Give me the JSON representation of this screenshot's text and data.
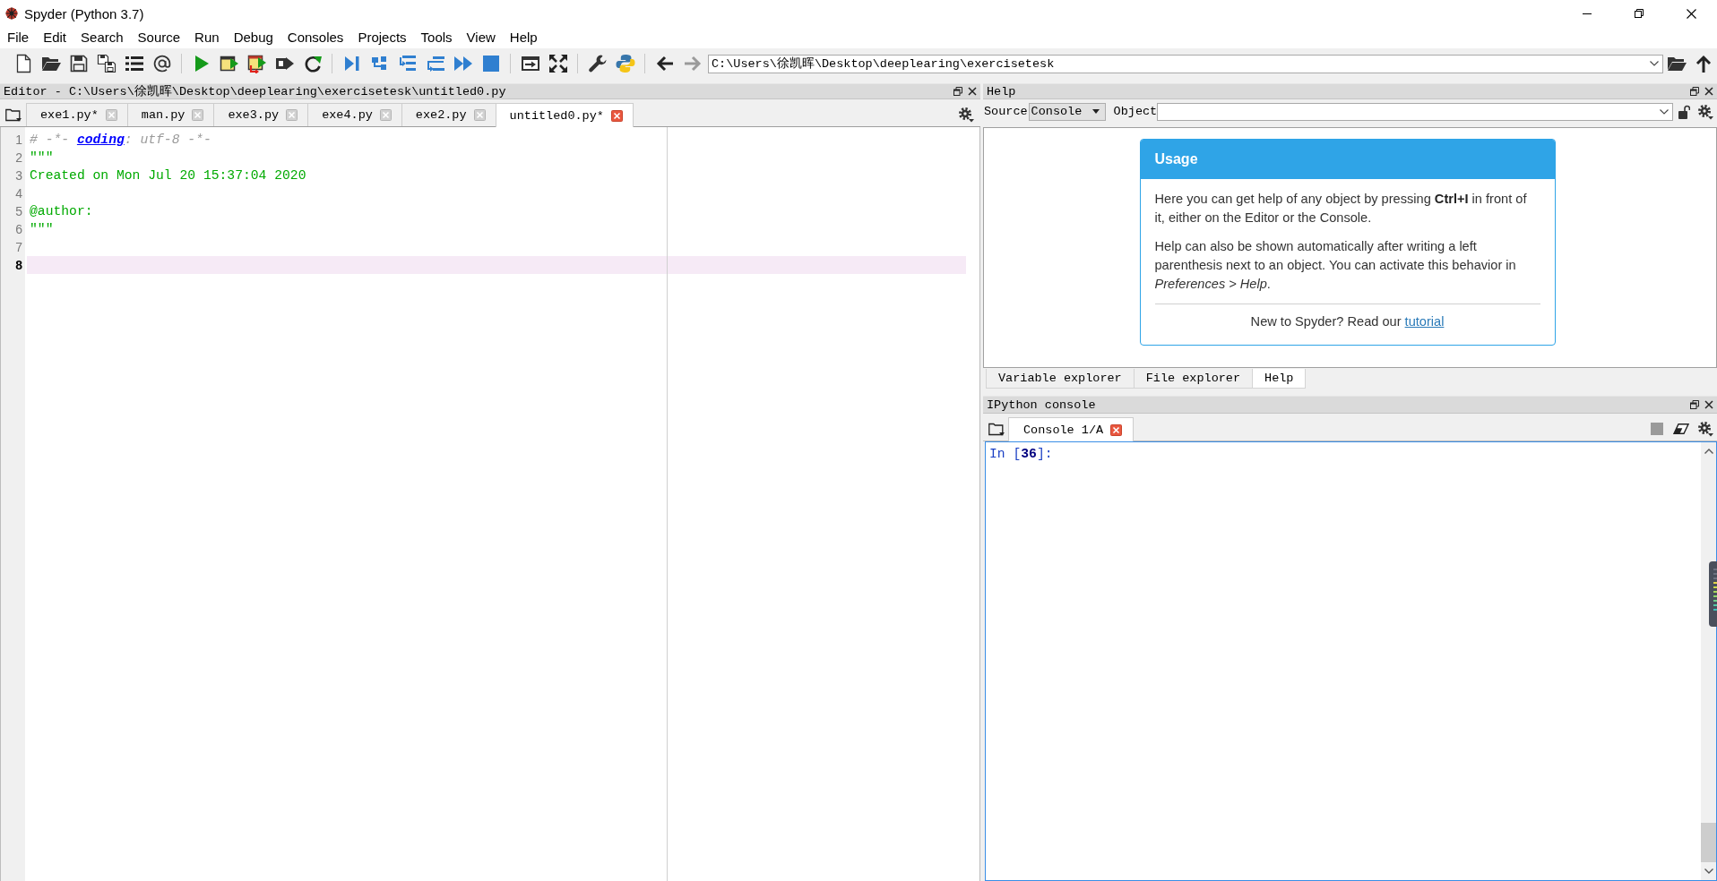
{
  "window": {
    "title": "Spyder (Python 3.7)"
  },
  "menu": [
    "File",
    "Edit",
    "Search",
    "Source",
    "Run",
    "Debug",
    "Consoles",
    "Projects",
    "Tools",
    "View",
    "Help"
  ],
  "toolbar": {
    "path": "C:\\Users\\徐凯晖\\Desktop\\deeplearing\\exercisetesk"
  },
  "editor": {
    "header": "Editor - C:\\Users\\徐凯晖\\Desktop\\deeplearing\\exercisetesk\\untitled0.py",
    "tabs": [
      {
        "label": "exe1.py*",
        "selected": false
      },
      {
        "label": "man.py",
        "selected": false
      },
      {
        "label": "exe3.py",
        "selected": false
      },
      {
        "label": "exe4.py",
        "selected": false
      },
      {
        "label": "exe2.py",
        "selected": false
      },
      {
        "label": "untitled0.py*",
        "selected": true
      }
    ],
    "lines": [
      {
        "number": "1",
        "current": false,
        "segments": [
          {
            "text": "# -*- ",
            "kind": "comment"
          },
          {
            "text": "coding",
            "kind": "special"
          },
          {
            "text": ": utf-8 -*-",
            "kind": "comment"
          }
        ]
      },
      {
        "number": "2",
        "current": false,
        "segments": [
          {
            "text": "\"\"\"",
            "kind": "string"
          }
        ]
      },
      {
        "number": "3",
        "current": false,
        "segments": [
          {
            "text": "Created on Mon Jul 20 15:37:04 2020",
            "kind": "string"
          }
        ]
      },
      {
        "number": "4",
        "current": false
      },
      {
        "number": "5",
        "current": false,
        "segments": [
          {
            "text": "@author:",
            "kind": "string"
          }
        ]
      },
      {
        "number": "6",
        "current": false,
        "segments": [
          {
            "text": "\"\"\"",
            "kind": "string"
          }
        ]
      },
      {
        "number": "7",
        "current": false
      },
      {
        "number": "8",
        "current": true
      }
    ]
  },
  "help": {
    "header": "Help",
    "source_label": "Source",
    "source_value": "Console",
    "object_label": "Object",
    "usage": {
      "title": "Usage",
      "paragraphs": [
        "Here you can get help of any object by pressing **Ctrl+I** in front of it, either on the Editor or the Console.",
        "Help can also be shown automatically after writing a left parenthesis next to an object. You can activate this behavior in *Preferences > Help*."
      ],
      "footer": "New to Spyder? Read our",
      "footer_link": "tutorial"
    }
  },
  "dock_tabs": [
    {
      "label": "Variable explorer",
      "selected": false
    },
    {
      "label": "File explorer",
      "selected": false
    },
    {
      "label": "Help",
      "selected": true
    }
  ],
  "console": {
    "header": "IPython console",
    "tabs": [
      {
        "label": "Console 1/A",
        "selected": true
      }
    ],
    "prompt": "In [**36**]:"
  }
}
